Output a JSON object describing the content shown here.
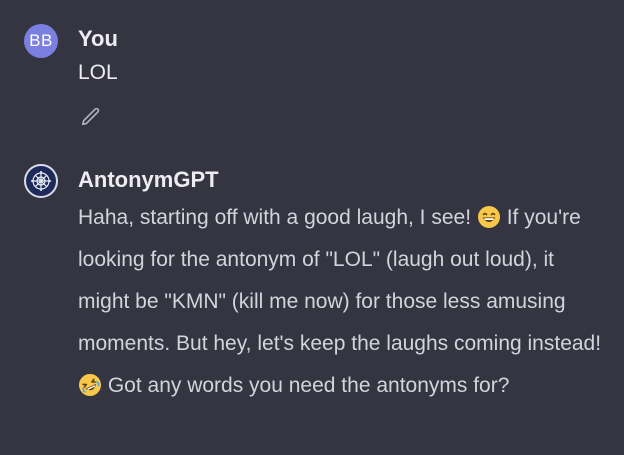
{
  "conversation": {
    "user": {
      "avatar_initials": "BB",
      "author": "You",
      "message": "LOL",
      "edit_icon": "pencil-icon"
    },
    "assistant": {
      "author": "AntonymGPT",
      "avatar_icon": "antonymgpt-logo",
      "segments": [
        "Haha, starting off with a good laugh, I see! ",
        " If you're looking for the antonym of \"LOL\" (laugh out loud), it might be \"KMN\" (kill me now) for those less amusing moments. But hey, let's keep the laughs coming instead! ",
        " Got any words you need the antonyms for?"
      ],
      "emojis": [
        "grinning-face-emoji",
        "rolling-on-floor-laughing-emoji"
      ]
    }
  },
  "colors": {
    "background": "#343541",
    "user_avatar": "#7b7fe0",
    "text": "#ececf1",
    "emoji_yellow": "#f7c84a"
  }
}
